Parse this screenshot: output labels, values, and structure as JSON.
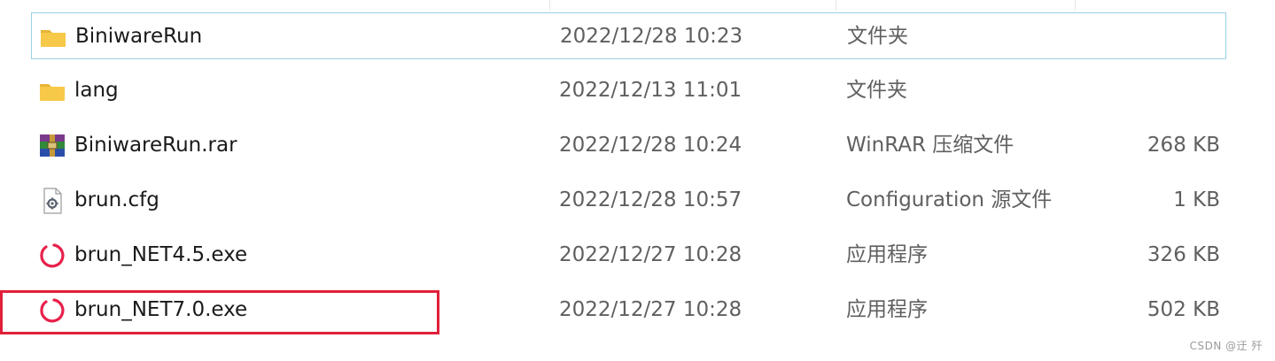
{
  "files": [
    {
      "name": "BiniwareRun",
      "date": "2022/12/28 10:23",
      "type": "文件夹",
      "size": "",
      "icon": "folder-icon",
      "selected": true
    },
    {
      "name": "lang",
      "date": "2022/12/13 11:01",
      "type": "文件夹",
      "size": "",
      "icon": "folder-icon",
      "selected": false
    },
    {
      "name": "BiniwareRun.rar",
      "date": "2022/12/28 10:24",
      "type": "WinRAR 压缩文件",
      "size": "268 KB",
      "icon": "winrar-archive-icon",
      "selected": false
    },
    {
      "name": "brun.cfg",
      "date": "2022/12/28 10:57",
      "type": "Configuration 源文件",
      "size": "1 KB",
      "icon": "config-file-icon",
      "selected": false
    },
    {
      "name": "brun_NET4.5.exe",
      "date": "2022/12/27 10:28",
      "type": "应用程序",
      "size": "326 KB",
      "icon": "app-ring-icon",
      "selected": false
    },
    {
      "name": "brun_NET7.0.exe",
      "date": "2022/12/27 10:28",
      "type": "应用程序",
      "size": "502 KB",
      "icon": "app-ring-icon",
      "selected": false
    }
  ],
  "watermark": "CSDN @迂 歼",
  "colors": {
    "highlight_border": "#e0203a",
    "selection_border": "#99d1e8",
    "folder": "#f7c948",
    "app_ring": "#e8204a"
  }
}
